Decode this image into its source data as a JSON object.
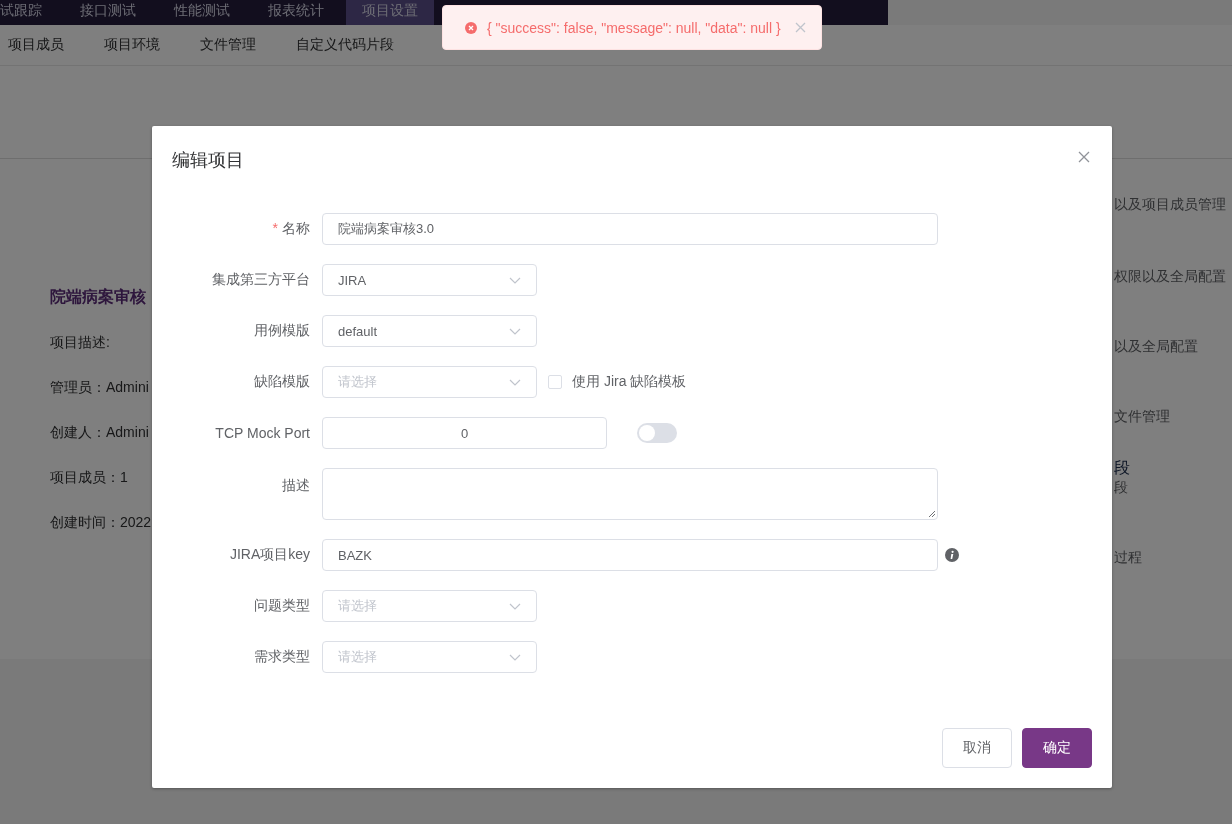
{
  "top_nav": [
    {
      "label": "试跟踪",
      "selected": false
    },
    {
      "label": "接口测试",
      "selected": false
    },
    {
      "label": "性能测试",
      "selected": false
    },
    {
      "label": "报表统计",
      "selected": false
    },
    {
      "label": "项目设置",
      "selected": true
    }
  ],
  "sub_nav": [
    "项目成员",
    "项目环境",
    "文件管理",
    "自定义代码片段"
  ],
  "project_card": {
    "title": "院端病案审核",
    "lines": [
      "项目描述:",
      "管理员：Admini",
      "创建人：Admini",
      "项目成员：1",
      "创建时间：2022"
    ]
  },
  "right_list": [
    {
      "kind": "desc",
      "text": "以及项目成员管理"
    },
    {
      "kind": "desc",
      "text": "权限以及全局配置"
    },
    {
      "kind": "desc",
      "text": "以及全局配置"
    },
    {
      "kind": "desc",
      "text": "文件管理"
    },
    {
      "kind": "title",
      "text": "段"
    },
    {
      "kind": "desc",
      "text": "段"
    },
    {
      "kind": "desc",
      "text": "过程"
    }
  ],
  "dialog": {
    "title": "编辑项目",
    "fields": [
      {
        "kind": "input",
        "label": "名称",
        "required_mark": "*",
        "value": "院端病案审核3.0"
      },
      {
        "kind": "select",
        "label": "集成第三方平台",
        "value": "JIRA"
      },
      {
        "kind": "select",
        "label": "用例模版",
        "value": "default"
      },
      {
        "kind": "select",
        "label": "缺陷模版",
        "placeholder": "请选择",
        "checkbox": {
          "label": "使用 Jira 缺陷模板",
          "checked": false
        }
      },
      {
        "kind": "number",
        "label": "TCP Mock Port",
        "value": "0",
        "switch_on": false
      },
      {
        "kind": "textarea",
        "label": "描述"
      },
      {
        "kind": "input",
        "label": "JIRA项目key",
        "value": "BAZK",
        "info": true
      },
      {
        "kind": "select",
        "label": "问题类型",
        "placeholder": "请选择"
      },
      {
        "kind": "select",
        "label": "需求类型",
        "placeholder": "请选择"
      }
    ],
    "buttons": [
      {
        "label": "取消",
        "primary": false
      },
      {
        "label": "确定",
        "primary": true
      }
    ]
  },
  "toast": {
    "message": "{ \"success\": false, \"message\": null, \"data\": null }"
  }
}
